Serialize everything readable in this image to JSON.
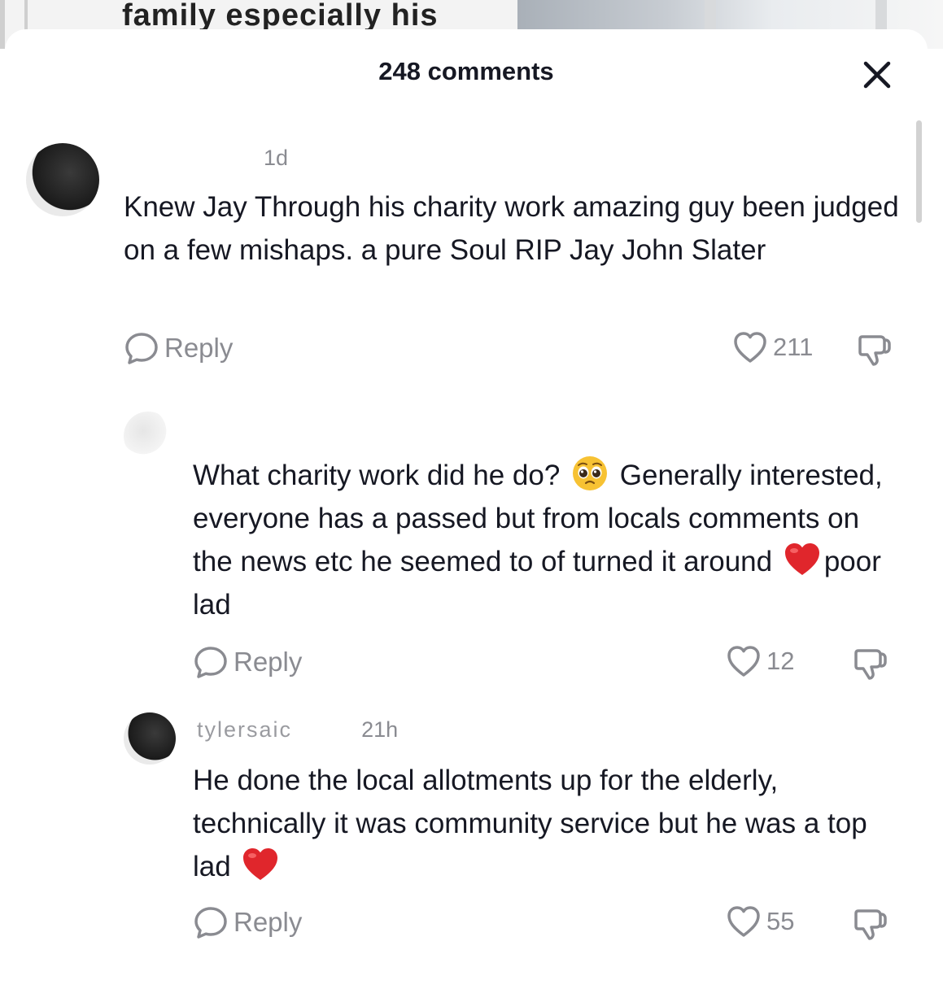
{
  "background": {
    "headline_fragment": "family especially his"
  },
  "sheet": {
    "title": "248 comments",
    "close_icon": "close-icon"
  },
  "comments": [
    {
      "username": "",
      "timestamp": "1d",
      "text": "Knew Jay Through his charity work amazing guy been judged on a few mishaps. a pure Soul RIP Jay John Slater",
      "reply_label": "Reply",
      "likes": "211"
    },
    {
      "username": "",
      "timestamp": "",
      "text_parts": [
        "What charity work did he do? ",
        " Generally interested, everyone has a passed but from locals comments on the news etc he seemed to of turned it around ",
        "poor lad"
      ],
      "emojis": [
        "pleading-face-emoji",
        "red-heart-emoji"
      ],
      "reply_label": "Reply",
      "likes": "12"
    },
    {
      "username": "tylersaic",
      "timestamp": "21h",
      "text": "He done the local allotments up for the elderly, technically it was community service but he was a top lad ",
      "emojis": [
        "red-heart-emoji"
      ],
      "reply_label": "Reply",
      "likes": "55"
    }
  ],
  "colors": {
    "text": "#161823",
    "secondary": "#8a8b91",
    "heart": "#ee1d52"
  }
}
